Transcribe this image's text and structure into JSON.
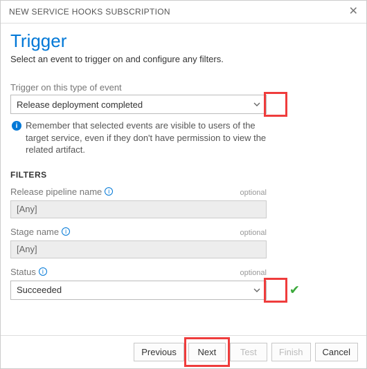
{
  "header": {
    "title": "NEW SERVICE HOOKS SUBSCRIPTION"
  },
  "page": {
    "heading": "Trigger",
    "subtitle": "Select an event to trigger on and configure any filters."
  },
  "event": {
    "label": "Trigger on this type of event",
    "selected": "Release deployment completed"
  },
  "info": {
    "text": "Remember that selected events are visible to users of the target service, even if they don't have permission to view the related artifact."
  },
  "filters": {
    "heading": "FILTERS",
    "optional_label": "optional",
    "pipeline": {
      "label": "Release pipeline name",
      "value": "[Any]"
    },
    "stage": {
      "label": "Stage name",
      "value": "[Any]"
    },
    "status": {
      "label": "Status",
      "selected": "Succeeded"
    }
  },
  "footer": {
    "previous": "Previous",
    "next": "Next",
    "test": "Test",
    "finish": "Finish",
    "cancel": "Cancel"
  }
}
